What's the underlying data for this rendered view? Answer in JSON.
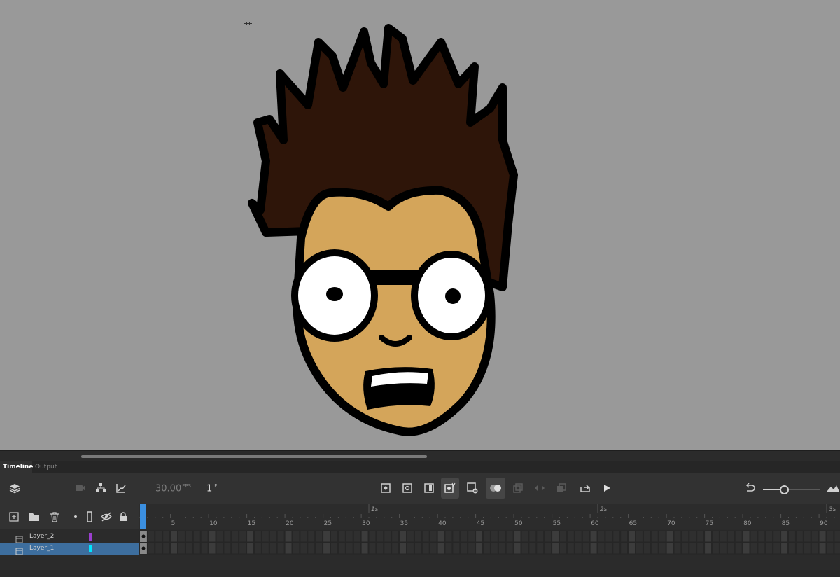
{
  "tabs": [
    {
      "label": "Timeline",
      "active": true
    },
    {
      "label": "Output",
      "active": false
    }
  ],
  "toolbar": {
    "fps_value": "30.00",
    "fps_unit": "FPS",
    "frame_value": "1",
    "frame_unit": "F"
  },
  "ruler": {
    "frame_labels": [
      "5",
      "10",
      "15",
      "20",
      "25",
      "30",
      "35",
      "40",
      "45",
      "50",
      "55",
      "60",
      "65",
      "70",
      "75",
      "80",
      "85",
      "90"
    ],
    "second_labels": [
      "1s",
      "2s",
      "3s"
    ]
  },
  "layers": [
    {
      "name": "Layer_2",
      "color": "#9b3fcf",
      "selected": false
    },
    {
      "name": "Layer_1",
      "color": "#00e5ff",
      "selected": true
    }
  ],
  "colors": {
    "stage": "#999999",
    "hair": "#2e1509",
    "skin": "#d4a55a",
    "outline": "#000000",
    "accent": "#3b8fe0"
  },
  "icons": [
    "layers-icon",
    "camera-icon",
    "layer-parenting-icon",
    "graph-icon",
    "insert-keyframe-icon",
    "insert-blank-keyframe-icon",
    "insert-frame-icon",
    "auto-keyframe-icon",
    "remove-frame-icon",
    "onion-skin-icon",
    "edit-multiple-frames-icon",
    "loop-icon",
    "play-icon",
    "undo-icon",
    "zoom-icon",
    "new-layer-icon",
    "new-folder-icon",
    "delete-layer-icon",
    "show-hide-icon",
    "outline-icon",
    "lock-icon"
  ]
}
